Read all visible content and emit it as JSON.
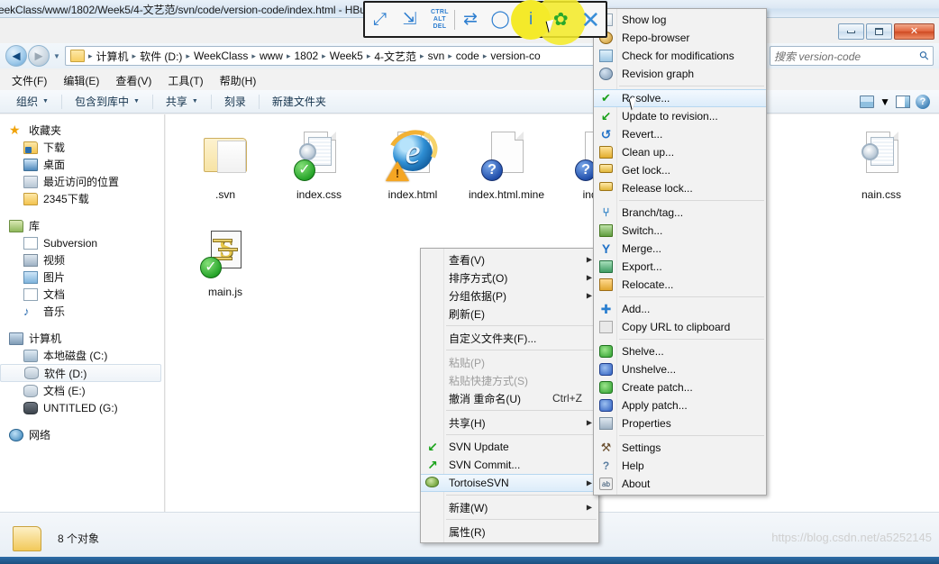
{
  "window": {
    "title": "eekClass/www/1802/Week5/4-文艺范/svn/code/version-code/index.html - HBu",
    "minimize_label": "最小化",
    "maximize_label": "最大化",
    "close_label": "关闭"
  },
  "address": {
    "back_glyph": "◄",
    "forward_glyph": "►",
    "dropdown_glyph": "▼",
    "crumbs": [
      "计算机",
      "软件 (D:)",
      "WeekClass",
      "www",
      "1802",
      "Week5",
      "4-文艺范",
      "svn",
      "code",
      "version-co"
    ],
    "separator": "▸",
    "tail_glyph": "▸"
  },
  "search": {
    "placeholder": "搜索 version-code",
    "icon": "search-icon"
  },
  "menubar": {
    "items": [
      "文件(F)",
      "编辑(E)",
      "查看(V)",
      "工具(T)",
      "帮助(H)"
    ]
  },
  "commandbar": {
    "items": [
      {
        "label": "组织",
        "caret": "▼"
      },
      {
        "label": "包含到库中",
        "caret": "▼"
      },
      {
        "label": "共享",
        "caret": "▼"
      },
      {
        "label": "刻录",
        "caret": ""
      },
      {
        "label": "新建文件夹",
        "caret": ""
      }
    ],
    "right": {
      "view_caret": "▼",
      "help_glyph": "?"
    }
  },
  "sidebar": {
    "groups": [
      {
        "header": {
          "label": "收藏夹",
          "icon": "star-icon"
        },
        "items": [
          {
            "label": "下载",
            "icon": "download-folder-icon"
          },
          {
            "label": "桌面",
            "icon": "desktop-icon"
          },
          {
            "label": "最近访问的位置",
            "icon": "recent-places-icon"
          },
          {
            "label": "2345下载",
            "icon": "folder-icon"
          }
        ]
      },
      {
        "header": {
          "label": "库",
          "icon": "library-icon"
        },
        "items": [
          {
            "label": "Subversion",
            "icon": "document-icon"
          },
          {
            "label": "视频",
            "icon": "video-icon"
          },
          {
            "label": "图片",
            "icon": "picture-icon"
          },
          {
            "label": "文档",
            "icon": "document-icon"
          },
          {
            "label": "音乐",
            "icon": "music-note-icon"
          }
        ]
      },
      {
        "header": {
          "label": "计算机",
          "icon": "computer-icon"
        },
        "items": [
          {
            "label": "本地磁盘 (C:)",
            "icon": "system-drive-icon",
            "selected": false
          },
          {
            "label": "软件 (D:)",
            "icon": "drive-icon",
            "selected": true
          },
          {
            "label": "文档 (E:)",
            "icon": "drive-icon",
            "selected": false
          },
          {
            "label": "UNTITLED (G:)",
            "icon": "usb-drive-icon",
            "selected": false
          }
        ]
      },
      {
        "header": {
          "label": "网络",
          "icon": "network-icon"
        },
        "items": []
      }
    ]
  },
  "files": [
    {
      "name": ".svn",
      "type": "folder",
      "overlay": "none"
    },
    {
      "name": "index.css",
      "type": "css",
      "overlay": "ok"
    },
    {
      "name": "index.html",
      "type": "html",
      "overlay": "conflict"
    },
    {
      "name": "index.html.mine",
      "type": "blank",
      "overlay": "question"
    },
    {
      "name": "index.h",
      "type": "blank",
      "overlay": "question"
    },
    {
      "name": "nain.css",
      "type": "css",
      "overlay": "none"
    },
    {
      "name": "main.js",
      "type": "js",
      "overlay": "ok"
    }
  ],
  "statusbar": {
    "text": "8 个对象",
    "icon": "folder-icon"
  },
  "context_menu": {
    "items": [
      {
        "label": "查看(V)",
        "submenu": true
      },
      {
        "label": "排序方式(O)",
        "submenu": true
      },
      {
        "label": "分组依据(P)",
        "submenu": true
      },
      {
        "label": "刷新(E)",
        "submenu": false
      },
      {
        "separator": true
      },
      {
        "label": "自定义文件夹(F)...",
        "submenu": false
      },
      {
        "separator": true
      },
      {
        "label": "粘贴(P)",
        "disabled": true
      },
      {
        "label": "粘贴快捷方式(S)",
        "disabled": true
      },
      {
        "label": "撤消 重命名(U)",
        "accel": "Ctrl+Z"
      },
      {
        "separator": true
      },
      {
        "label": "共享(H)",
        "submenu": true
      },
      {
        "separator": true
      },
      {
        "label": "SVN Update",
        "icon": "svn-update-icon",
        "icon_glyph": "↙"
      },
      {
        "label": "SVN Commit...",
        "icon": "svn-commit-icon",
        "icon_glyph": "↗"
      },
      {
        "label": "TortoiseSVN",
        "icon": "tortoise-icon",
        "submenu": true,
        "highlighted": true
      },
      {
        "separator": true
      },
      {
        "label": "新建(W)",
        "submenu": true
      },
      {
        "separator": true
      },
      {
        "label": "属性(R)",
        "submenu": false
      }
    ]
  },
  "submenu": {
    "title": "TortoiseSVN",
    "items": [
      {
        "label": "Show log",
        "icon": "show-log-icon"
      },
      {
        "label": "Repo-browser",
        "icon": "repo-browser-icon"
      },
      {
        "label": "Check for modifications",
        "icon": "check-modifications-icon"
      },
      {
        "label": "Revision graph",
        "icon": "revision-graph-icon"
      },
      {
        "separator": true
      },
      {
        "label": "Resolve...",
        "icon": "resolve-icon",
        "highlighted": true
      },
      {
        "label": "Update to revision...",
        "icon": "update-revision-icon"
      },
      {
        "label": "Revert...",
        "icon": "revert-icon"
      },
      {
        "label": "Clean up...",
        "icon": "cleanup-icon"
      },
      {
        "label": "Get lock...",
        "icon": "get-lock-icon"
      },
      {
        "label": "Release lock...",
        "icon": "release-lock-icon"
      },
      {
        "separator": true
      },
      {
        "label": "Branch/tag...",
        "icon": "branch-tag-icon"
      },
      {
        "label": "Switch...",
        "icon": "switch-icon"
      },
      {
        "label": "Merge...",
        "icon": "merge-icon"
      },
      {
        "label": "Export...",
        "icon": "export-icon"
      },
      {
        "label": "Relocate...",
        "icon": "relocate-icon"
      },
      {
        "separator": true
      },
      {
        "label": "Add...",
        "icon": "add-icon"
      },
      {
        "label": "Copy URL to clipboard",
        "icon": "copy-url-icon"
      },
      {
        "separator": true
      },
      {
        "label": "Shelve...",
        "icon": "shelve-icon"
      },
      {
        "label": "Unshelve...",
        "icon": "unshelve-icon"
      },
      {
        "label": "Create patch...",
        "icon": "create-patch-icon"
      },
      {
        "label": "Apply patch...",
        "icon": "apply-patch-icon"
      },
      {
        "label": "Properties",
        "icon": "properties-icon"
      },
      {
        "separator": true
      },
      {
        "label": "Settings",
        "icon": "settings-icon"
      },
      {
        "label": "Help",
        "icon": "help-icon"
      },
      {
        "label": "About",
        "icon": "about-icon"
      }
    ]
  },
  "vm_toolbar": {
    "buttons": [
      {
        "name": "fullscreen-icon",
        "glyph": "⤢"
      },
      {
        "name": "fit-window-icon",
        "glyph": "⇲"
      },
      {
        "name": "ctrl-alt-del-icon",
        "line1": "CTRL",
        "line2": "ALT",
        "line3": "DEL"
      },
      {
        "name": "transfer-icon",
        "glyph": "⇄"
      },
      {
        "name": "chat-icon",
        "glyph": "◯"
      },
      {
        "name": "info-icon",
        "glyph": "i"
      },
      {
        "name": "settings-gear-icon",
        "glyph": "✿"
      },
      {
        "name": "close-icon",
        "glyph": "✕"
      }
    ]
  },
  "watermark": {
    "text": "https://blog.csdn.net/a5252145"
  }
}
